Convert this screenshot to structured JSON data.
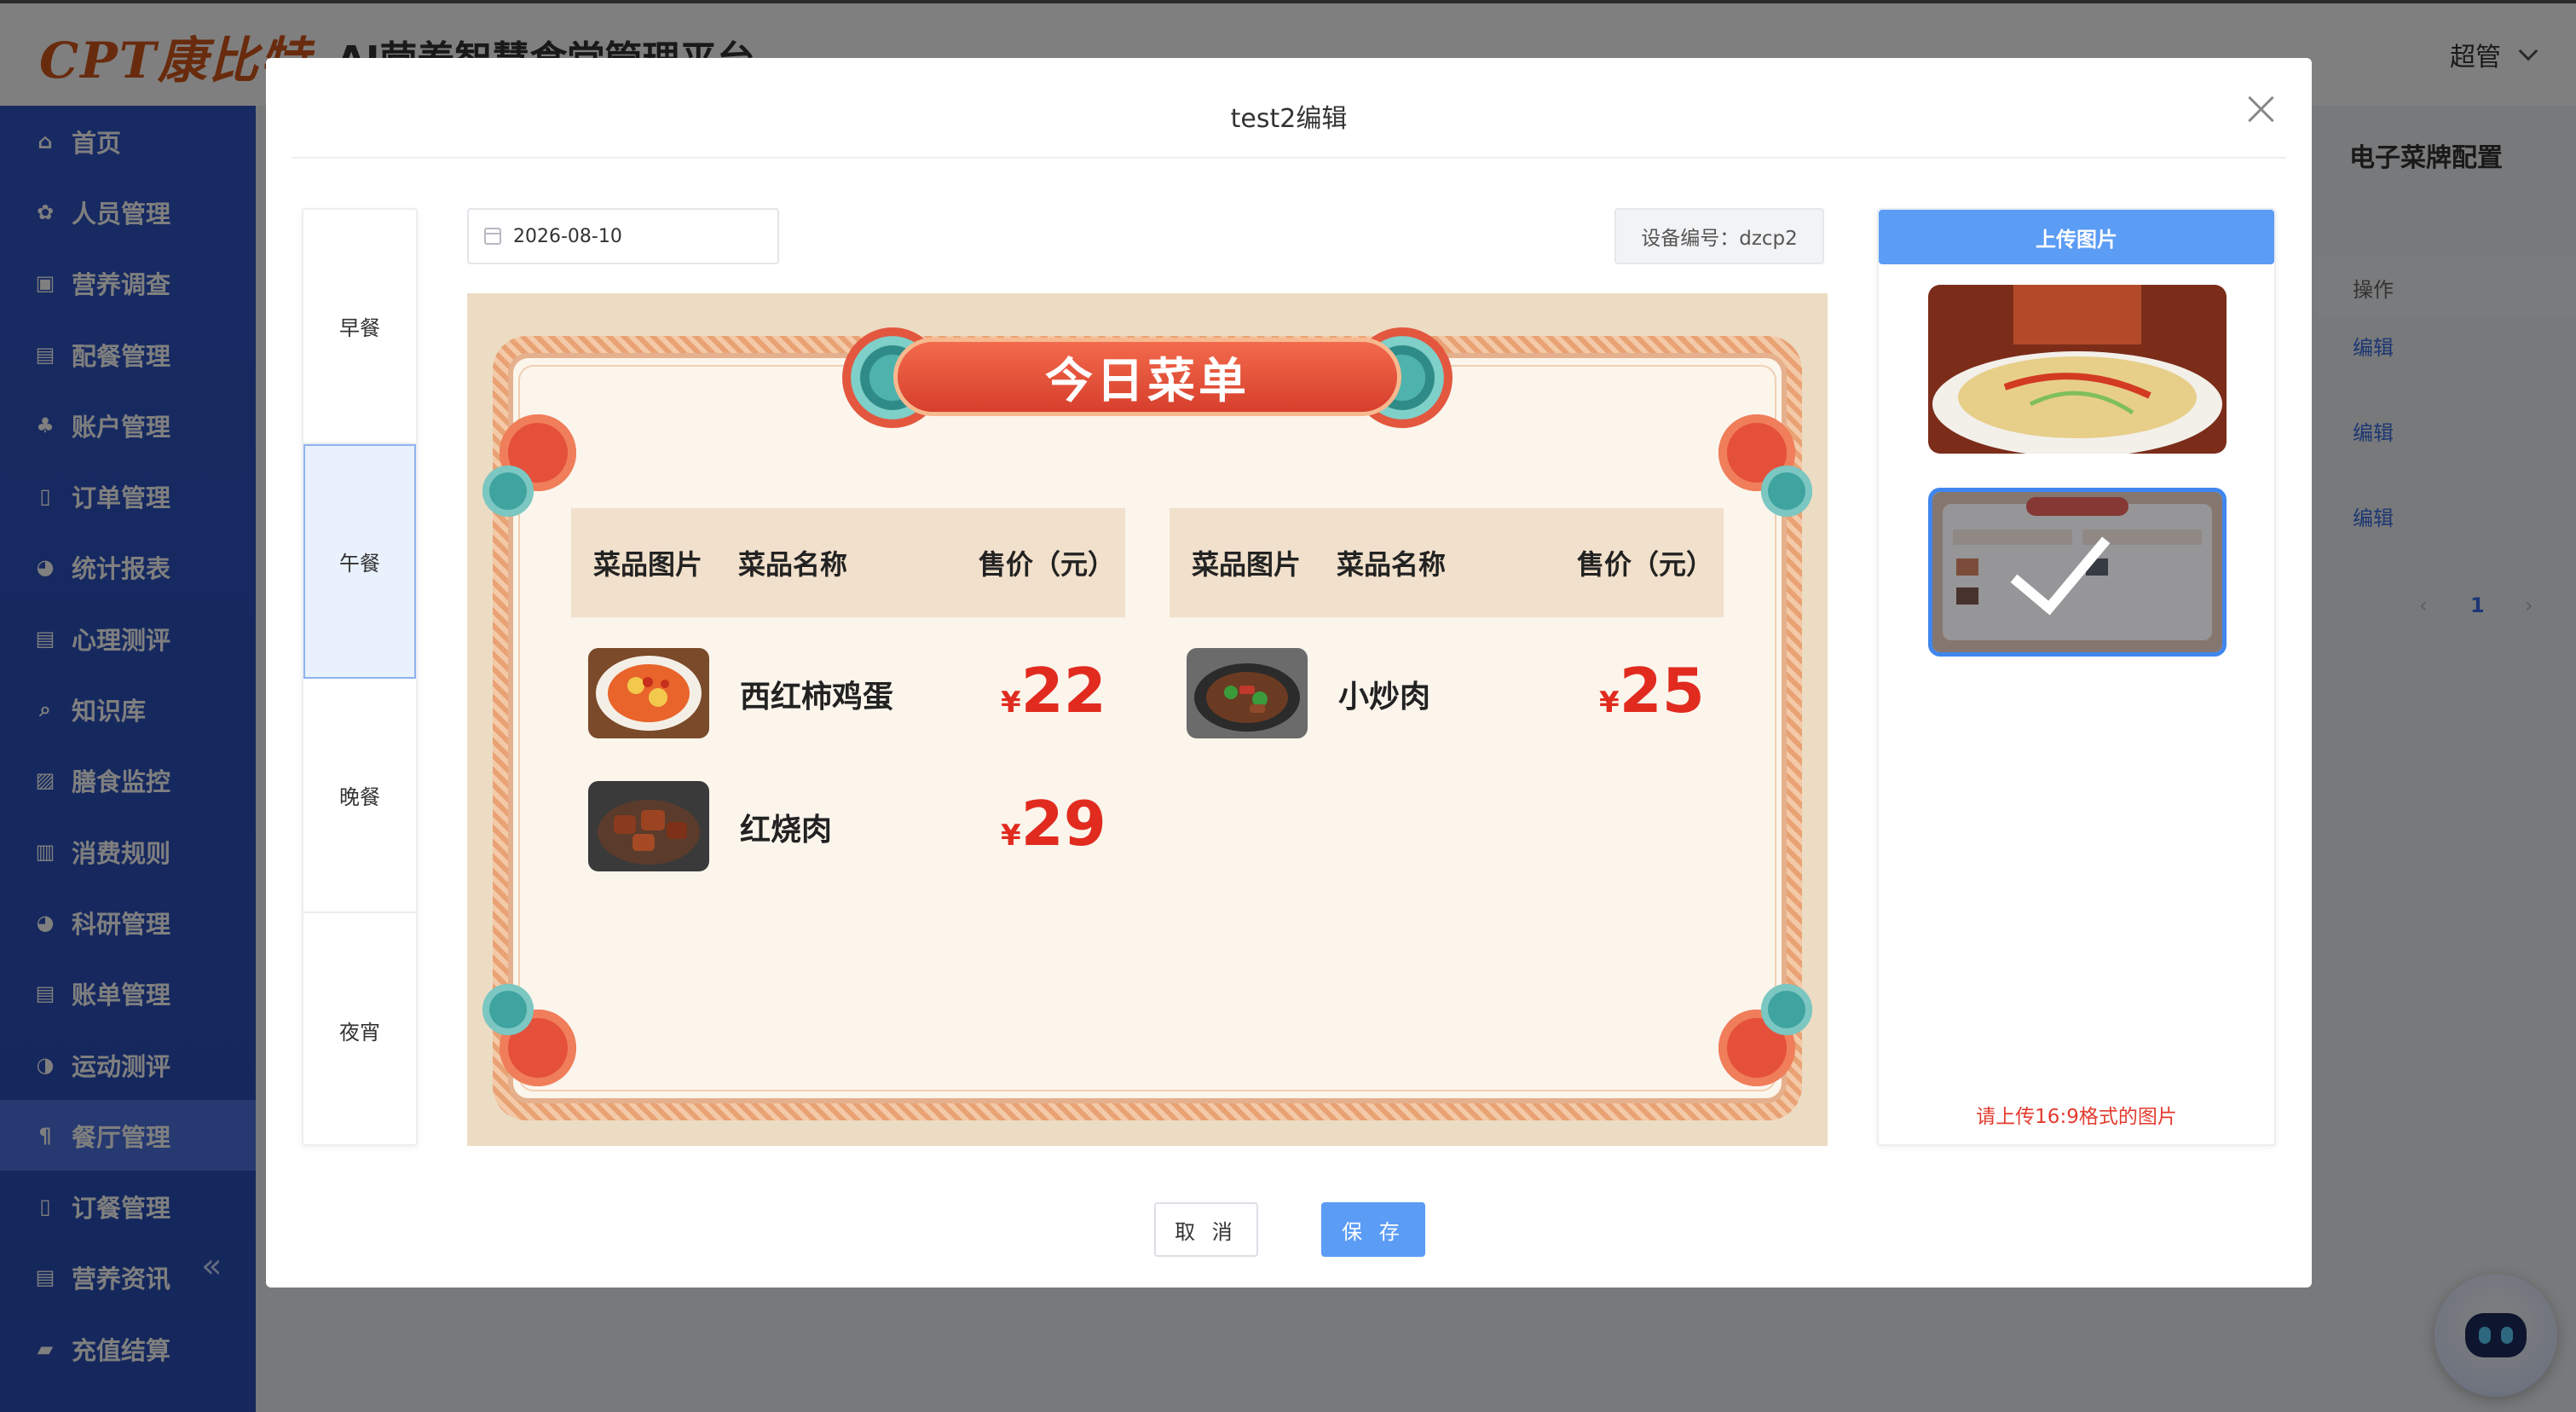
{
  "app": {
    "logo_text": "CPT康比特",
    "title": "AI营养智慧食堂管理平台",
    "user": "超管"
  },
  "sidebar": {
    "items": [
      {
        "label": "首页",
        "icon": "home-icon",
        "glyph": "⌂"
      },
      {
        "label": "人员管理",
        "icon": "people-icon",
        "glyph": "✿"
      },
      {
        "label": "营养调查",
        "icon": "survey-icon",
        "glyph": "▣"
      },
      {
        "label": "配餐管理",
        "icon": "meal-plan-icon",
        "glyph": "▤"
      },
      {
        "label": "账户管理",
        "icon": "account-icon",
        "glyph": "♣"
      },
      {
        "label": "订单管理",
        "icon": "order-icon",
        "glyph": "▯"
      },
      {
        "label": "统计报表",
        "icon": "chart-pie-icon",
        "glyph": "◕"
      },
      {
        "label": "心理测评",
        "icon": "mind-icon",
        "glyph": "▤"
      },
      {
        "label": "知识库",
        "icon": "knowledge-icon",
        "glyph": "⌕"
      },
      {
        "label": "膳食监控",
        "icon": "monitor-icon",
        "glyph": "▨"
      },
      {
        "label": "消费规则",
        "icon": "rules-icon",
        "glyph": "▥"
      },
      {
        "label": "科研管理",
        "icon": "research-icon",
        "glyph": "◕"
      },
      {
        "label": "账单管理",
        "icon": "bill-icon",
        "glyph": "▤"
      },
      {
        "label": "运动测评",
        "icon": "sport-icon",
        "glyph": "◑"
      },
      {
        "label": "餐厅管理",
        "icon": "restaurant-icon",
        "glyph": "¶",
        "active": true
      },
      {
        "label": "订餐管理",
        "icon": "booking-icon",
        "glyph": "▯"
      },
      {
        "label": "营养资讯",
        "icon": "news-icon",
        "glyph": "▤"
      },
      {
        "label": "充值结算",
        "icon": "recharge-icon",
        "glyph": "▰"
      }
    ]
  },
  "background_page": {
    "panel_title": "电子菜牌配置",
    "table_header": "操作",
    "edit_links": [
      "编辑",
      "编辑",
      "编辑"
    ],
    "pagination": {
      "prev": "‹",
      "current": "1",
      "next": "›"
    }
  },
  "modal": {
    "title": "test2编辑",
    "meal_tabs": [
      "早餐",
      "午餐",
      "晚餐",
      "夜宵"
    ],
    "active_meal_index": 1,
    "date_value": "2026-08-10",
    "device_label": "设备编号：dzcp2",
    "upload_label": "上传图片",
    "hint": "请上传16:9格式的图片",
    "cancel_label": "取 消",
    "save_label": "保 存"
  },
  "menu_board": {
    "banner": "今日菜单",
    "columns_left": {
      "img": "菜品图片",
      "name": "菜品名称",
      "price": "售价（元）"
    },
    "columns_right": {
      "img": "菜品图片",
      "name": "菜品名称",
      "price": "售价（元）"
    },
    "dishes_left": [
      {
        "name": "西红柿鸡蛋",
        "currency": "¥",
        "price": "22"
      },
      {
        "name": "红烧肉",
        "currency": "¥",
        "price": "29"
      }
    ],
    "dishes_right": [
      {
        "name": "小炒肉",
        "currency": "¥",
        "price": "25"
      }
    ]
  },
  "colors": {
    "primary": "#5b9cf5",
    "sidebar": "#2f55c4",
    "price_red": "#e12b1f",
    "hint_red": "#e33b2e"
  }
}
